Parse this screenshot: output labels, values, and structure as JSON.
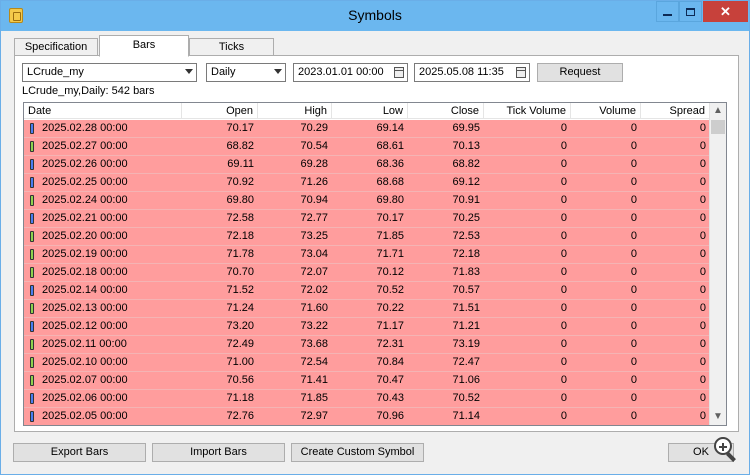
{
  "window": {
    "title": "Symbols"
  },
  "tabs": [
    "Specification",
    "Bars",
    "Ticks"
  ],
  "controls": {
    "symbol": "LCrude_my",
    "timeframe": "Daily",
    "date_from": "2023.01.01 00:00",
    "date_to": "2025.05.08 11:35",
    "request_label": "Request"
  },
  "summary": "LCrude_my,Daily: 542 bars",
  "table": {
    "columns": [
      "Date",
      "Open",
      "High",
      "Low",
      "Close",
      "Tick Volume",
      "Volume",
      "Spread"
    ],
    "rows": [
      {
        "date": "2025.02.28 00:00",
        "open": "70.17",
        "high": "70.29",
        "low": "69.14",
        "close": "69.95",
        "tick_volume": "0",
        "volume": "0",
        "spread": "0",
        "bar": "bear"
      },
      {
        "date": "2025.02.27 00:00",
        "open": "68.82",
        "high": "70.54",
        "low": "68.61",
        "close": "70.13",
        "tick_volume": "0",
        "volume": "0",
        "spread": "0",
        "bar": "bull"
      },
      {
        "date": "2025.02.26 00:00",
        "open": "69.11",
        "high": "69.28",
        "low": "68.36",
        "close": "68.82",
        "tick_volume": "0",
        "volume": "0",
        "spread": "0",
        "bar": "bear"
      },
      {
        "date": "2025.02.25 00:00",
        "open": "70.92",
        "high": "71.26",
        "low": "68.68",
        "close": "69.12",
        "tick_volume": "0",
        "volume": "0",
        "spread": "0",
        "bar": "bear"
      },
      {
        "date": "2025.02.24 00:00",
        "open": "69.80",
        "high": "70.94",
        "low": "69.80",
        "close": "70.91",
        "tick_volume": "0",
        "volume": "0",
        "spread": "0",
        "bar": "bull"
      },
      {
        "date": "2025.02.21 00:00",
        "open": "72.58",
        "high": "72.77",
        "low": "70.17",
        "close": "70.25",
        "tick_volume": "0",
        "volume": "0",
        "spread": "0",
        "bar": "bear"
      },
      {
        "date": "2025.02.20 00:00",
        "open": "72.18",
        "high": "73.25",
        "low": "71.85",
        "close": "72.53",
        "tick_volume": "0",
        "volume": "0",
        "spread": "0",
        "bar": "bull"
      },
      {
        "date": "2025.02.19 00:00",
        "open": "71.78",
        "high": "73.04",
        "low": "71.71",
        "close": "72.18",
        "tick_volume": "0",
        "volume": "0",
        "spread": "0",
        "bar": "bull"
      },
      {
        "date": "2025.02.18 00:00",
        "open": "70.70",
        "high": "72.07",
        "low": "70.12",
        "close": "71.83",
        "tick_volume": "0",
        "volume": "0",
        "spread": "0",
        "bar": "bull"
      },
      {
        "date": "2025.02.14 00:00",
        "open": "71.52",
        "high": "72.02",
        "low": "70.52",
        "close": "70.57",
        "tick_volume": "0",
        "volume": "0",
        "spread": "0",
        "bar": "bear"
      },
      {
        "date": "2025.02.13 00:00",
        "open": "71.24",
        "high": "71.60",
        "low": "70.22",
        "close": "71.51",
        "tick_volume": "0",
        "volume": "0",
        "spread": "0",
        "bar": "bull"
      },
      {
        "date": "2025.02.12 00:00",
        "open": "73.20",
        "high": "73.22",
        "low": "71.17",
        "close": "71.21",
        "tick_volume": "0",
        "volume": "0",
        "spread": "0",
        "bar": "bear"
      },
      {
        "date": "2025.02.11 00:00",
        "open": "72.49",
        "high": "73.68",
        "low": "72.31",
        "close": "73.19",
        "tick_volume": "0",
        "volume": "0",
        "spread": "0",
        "bar": "bull"
      },
      {
        "date": "2025.02.10 00:00",
        "open": "71.00",
        "high": "72.54",
        "low": "70.84",
        "close": "72.47",
        "tick_volume": "0",
        "volume": "0",
        "spread": "0",
        "bar": "bull"
      },
      {
        "date": "2025.02.07 00:00",
        "open": "70.56",
        "high": "71.41",
        "low": "70.47",
        "close": "71.06",
        "tick_volume": "0",
        "volume": "0",
        "spread": "0",
        "bar": "bull"
      },
      {
        "date": "2025.02.06 00:00",
        "open": "71.18",
        "high": "71.85",
        "low": "70.43",
        "close": "70.52",
        "tick_volume": "0",
        "volume": "0",
        "spread": "0",
        "bar": "bear"
      },
      {
        "date": "2025.02.05 00:00",
        "open": "72.76",
        "high": "72.97",
        "low": "70.96",
        "close": "71.14",
        "tick_volume": "0",
        "volume": "0",
        "spread": "0",
        "bar": "bear"
      }
    ]
  },
  "footer": {
    "export_label": "Export Bars",
    "import_label": "Import Bars",
    "custom_label": "Create Custom Symbol",
    "ok_label": "OK"
  },
  "colors": {
    "row_bg": "#ff9d9d",
    "title_bar": "#6bb7ef",
    "bull_icon": "#8ed24e",
    "bear_icon": "#4a7df0"
  }
}
